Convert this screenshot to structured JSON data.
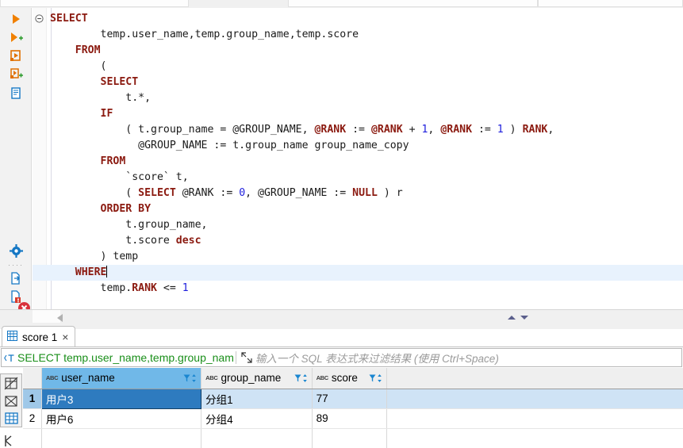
{
  "app": {
    "type": "sql-editor",
    "colors": {
      "keyword": "#8b1a10",
      "number": "#2020dd",
      "sql_green": "#1a8f1a",
      "selection_blue": "#2e7bbf",
      "header_selected": "#70b8e8",
      "current_line": "#e8f2fd"
    }
  },
  "toolbar": {
    "icons": [
      {
        "name": "execute-statement-icon",
        "title": "Execute SQL Statement"
      },
      {
        "name": "execute-new-tab-icon",
        "title": "Execute SQL in new tab"
      },
      {
        "name": "execute-script-icon",
        "title": "Execute script"
      },
      {
        "name": "execute-script-new-tab-icon",
        "title": "Execute script in new tab"
      },
      {
        "name": "explain-plan-icon",
        "title": "Explain execution plan"
      },
      {
        "name": "settings-gear-icon",
        "title": "Settings"
      },
      {
        "name": "export-data-icon",
        "title": "Export data"
      },
      {
        "name": "script-error-icon",
        "title": "Script has errors"
      },
      {
        "name": "value-panel-icon",
        "title": "Value panel"
      }
    ],
    "error_badge": "error-marker-icon"
  },
  "editor": {
    "fold_marker": "collapse-fold-icon",
    "cursor_line": 16,
    "lines": [
      [
        {
          "t": "SELECT",
          "c": "kw"
        }
      ],
      [
        {
          "t": "        temp.user_name,temp.group_name,temp.score",
          "c": "var"
        }
      ],
      [
        {
          "t": "    ",
          "c": "var"
        },
        {
          "t": "FROM",
          "c": "kw"
        }
      ],
      [
        {
          "t": "        (",
          "c": "var"
        }
      ],
      [
        {
          "t": "        ",
          "c": "var"
        },
        {
          "t": "SELECT",
          "c": "kw"
        }
      ],
      [
        {
          "t": "            t.*,",
          "c": "var"
        }
      ],
      [
        {
          "t": "        ",
          "c": "var"
        },
        {
          "t": "IF",
          "c": "kw"
        }
      ],
      [
        {
          "t": "            ( t.group_name = @GROUP_NAME, ",
          "c": "var"
        },
        {
          "t": "@RANK",
          "c": "varr"
        },
        {
          "t": " := ",
          "c": "var"
        },
        {
          "t": "@RANK",
          "c": "varr"
        },
        {
          "t": " + ",
          "c": "var"
        },
        {
          "t": "1",
          "c": "num"
        },
        {
          "t": ", ",
          "c": "var"
        },
        {
          "t": "@RANK",
          "c": "varr"
        },
        {
          "t": " := ",
          "c": "var"
        },
        {
          "t": "1",
          "c": "num"
        },
        {
          "t": " ) ",
          "c": "var"
        },
        {
          "t": "RANK",
          "c": "varr"
        },
        {
          "t": ",",
          "c": "var"
        }
      ],
      [
        {
          "t": "              @GROUP_NAME := t.group_name group_name_copy",
          "c": "var"
        }
      ],
      [
        {
          "t": "        ",
          "c": "var"
        },
        {
          "t": "FROM",
          "c": "kw"
        }
      ],
      [
        {
          "t": "            `score` t,",
          "c": "var"
        }
      ],
      [
        {
          "t": "            ( ",
          "c": "var"
        },
        {
          "t": "SELECT",
          "c": "kw"
        },
        {
          "t": " @RANK := ",
          "c": "var"
        },
        {
          "t": "0",
          "c": "num"
        },
        {
          "t": ", @GROUP_NAME := ",
          "c": "var"
        },
        {
          "t": "NULL",
          "c": "kw"
        },
        {
          "t": " ) r",
          "c": "var"
        }
      ],
      [
        {
          "t": "        ",
          "c": "var"
        },
        {
          "t": "ORDER BY",
          "c": "kw"
        }
      ],
      [
        {
          "t": "            t.group_name,",
          "c": "var"
        }
      ],
      [
        {
          "t": "            t.score ",
          "c": "var"
        },
        {
          "t": "desc",
          "c": "kw"
        }
      ],
      [
        {
          "t": "        ) temp",
          "c": "var"
        }
      ],
      [
        {
          "t": "    ",
          "c": "var"
        },
        {
          "t": "WHERE",
          "c": "kw"
        }
      ],
      [
        {
          "t": "        temp.",
          "c": "var"
        },
        {
          "t": "RANK",
          "c": "varr"
        },
        {
          "t": " <= ",
          "c": "var"
        },
        {
          "t": "1",
          "c": "num"
        }
      ]
    ]
  },
  "results": {
    "tab": {
      "label": "score 1",
      "icon": "grid-table-icon",
      "close": "×"
    },
    "filter": {
      "icon": "sql-text-icon",
      "sql_text": "SELECT temp.user_name,temp.group_nam",
      "expand_icon": "expand-arrows-icon",
      "placeholder": "输入一个 SQL 表达式来过滤结果 (使用 Ctrl+Space)"
    },
    "panel_nav": {
      "up": "scroll-up-icon",
      "down": "scroll-down-icon",
      "scroll_left": "scroll-left-icon"
    },
    "side_icons": [
      {
        "name": "grid-presentation-icon"
      },
      {
        "name": "record-presentation-icon"
      },
      {
        "name": "grid-view-icon"
      },
      {
        "name": "transpose-icon"
      }
    ],
    "grid": {
      "columns": [
        {
          "name": "user_name",
          "type": "ABC",
          "selected": true
        },
        {
          "name": "group_name",
          "type": "ABC",
          "selected": false
        },
        {
          "name": "score",
          "type": "ABC",
          "selected": false
        }
      ],
      "rows": [
        {
          "num": "1",
          "cells": [
            "用户3",
            "分组1",
            "77"
          ],
          "selected": true
        },
        {
          "num": "2",
          "cells": [
            "用户6",
            "分组4",
            "89"
          ],
          "selected": false
        },
        {
          "num": "",
          "cells": [
            "",
            "",
            ""
          ],
          "selected": false
        }
      ]
    }
  }
}
